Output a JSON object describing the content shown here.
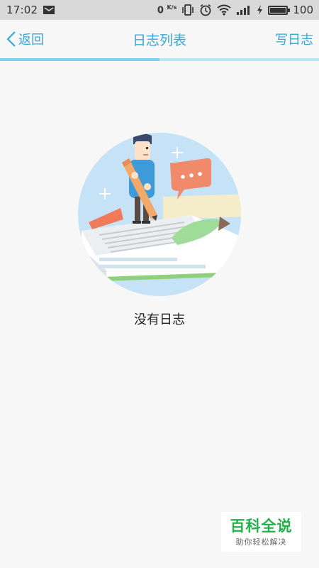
{
  "status_bar": {
    "time": "17:02",
    "network_speed": "0",
    "network_unit": "K/s",
    "battery": "100",
    "battery_level": 1.0,
    "icons": [
      "message-icon",
      "vibrate-icon",
      "alarm-icon",
      "wifi-icon",
      "signal-icon",
      "charging-icon",
      "battery-icon"
    ]
  },
  "header": {
    "back_label": "返回",
    "title": "日志列表",
    "write_label": "写日志"
  },
  "progress": {
    "fraction": 0.5
  },
  "empty_state": {
    "message": "没有日志",
    "illustration": "man-writing-with-pencil"
  },
  "watermark": {
    "main": "百科全说",
    "sub": "助你轻松解决"
  },
  "colors": {
    "accent": "#35a9d8",
    "background": "#f7f7f7",
    "status_bar": "#d9d9d9",
    "watermark_green": "#23b04a"
  }
}
